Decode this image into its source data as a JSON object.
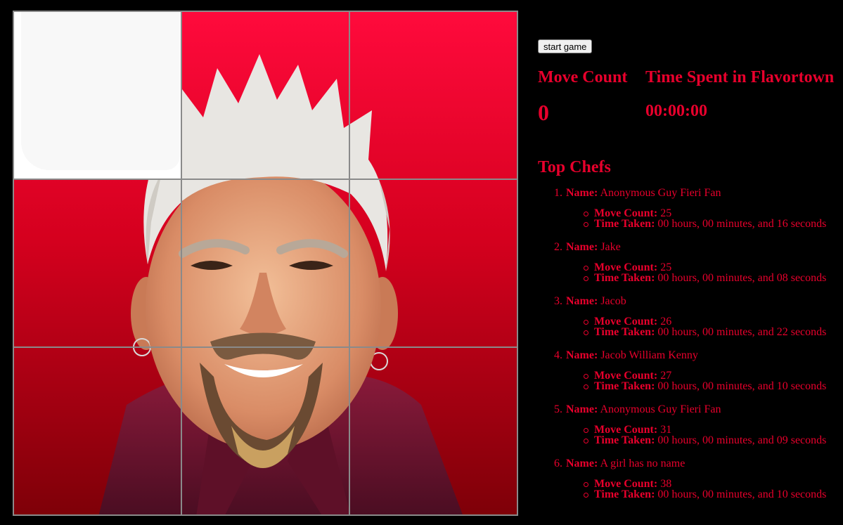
{
  "game": {
    "start_label": "start game",
    "move_count_label": "Move Count",
    "move_count_value": "0",
    "time_label": "Time Spent in Flavortown",
    "time_value": "00:00:00"
  },
  "leaderboard": {
    "title": "Top Chefs",
    "name_label": "Name:",
    "moves_label": "Move Count:",
    "time_label": "Time Taken:",
    "entries": [
      {
        "rank": "1.",
        "name": "Anonymous Guy Fieri Fan",
        "moves": "25",
        "time": "00 hours, 00 minutes, and 16 seconds"
      },
      {
        "rank": "2.",
        "name": "Jake",
        "moves": "25",
        "time": "00 hours, 00 minutes, and 08 seconds"
      },
      {
        "rank": "3.",
        "name": "Jacob",
        "moves": "26",
        "time": "00 hours, 00 minutes, and 22 seconds"
      },
      {
        "rank": "4.",
        "name": "Jacob William Kenny",
        "moves": "27",
        "time": "00 hours, 00 minutes, and 10 seconds"
      },
      {
        "rank": "5.",
        "name": "Anonymous Guy Fieri Fan",
        "moves": "31",
        "time": "00 hours, 00 minutes, and 09 seconds"
      },
      {
        "rank": "6.",
        "name": "A girl has no name",
        "moves": "38",
        "time": "00 hours, 00 minutes, and 10 seconds"
      }
    ]
  },
  "colors": {
    "accent": "#e8002c",
    "background": "#000000",
    "tile_border": "#8a8a8a"
  },
  "puzzle": {
    "grid_size": 3,
    "empty_tile": 1
  }
}
